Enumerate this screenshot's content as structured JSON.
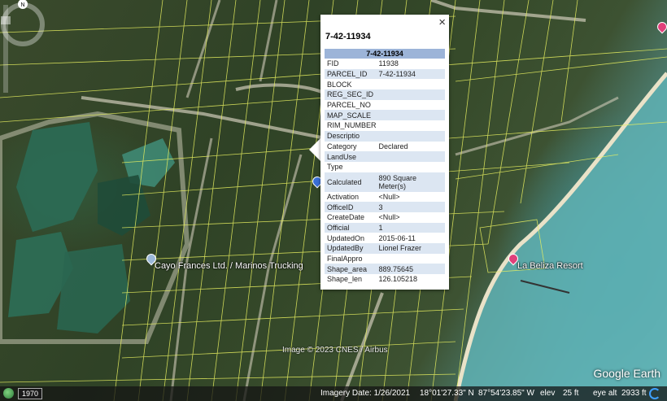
{
  "map": {
    "place_labels": [
      {
        "text": "Cayo Frances Ltd. / Marinos Trucking"
      },
      {
        "text": "La Beliza Resort"
      }
    ],
    "imagery_credit": "Image © 2023 CNES / Airbus",
    "brand": "Google Earth",
    "compass_label": "N"
  },
  "popup": {
    "title": "7-42-11934",
    "table_header": "7-42-11934",
    "close_glyph": "×",
    "rows": [
      {
        "key": "FID",
        "value": "11938"
      },
      {
        "key": "PARCEL_ID",
        "value": "7-42-11934"
      },
      {
        "key": "BLOCK",
        "value": ""
      },
      {
        "key": "REG_SEC_ID",
        "value": ""
      },
      {
        "key": "PARCEL_NO",
        "value": ""
      },
      {
        "key": "MAP_SCALE",
        "value": ""
      },
      {
        "key": "RIM_NUMBER",
        "value": ""
      },
      {
        "key": "Descriptio",
        "value": ""
      },
      {
        "key": "Category",
        "value": "Declared"
      },
      {
        "key": "LandUse",
        "value": ""
      },
      {
        "key": "Type",
        "value": ""
      },
      {
        "key": "Calculated",
        "value": "890 Square Meter(s)"
      },
      {
        "key": "Activation",
        "value": "<Null>"
      },
      {
        "key": "OfficeID",
        "value": "3"
      },
      {
        "key": "CreateDate",
        "value": "<Null>"
      },
      {
        "key": "Official",
        "value": "1"
      },
      {
        "key": "UpdatedOn",
        "value": "2015-06-11"
      },
      {
        "key": "UpdatedBy",
        "value": "Lionel Frazer"
      },
      {
        "key": "FinalAppro",
        "value": ""
      },
      {
        "key": "Shape_area",
        "value": "889.75645"
      },
      {
        "key": "Shape_len",
        "value": "126.105218"
      }
    ]
  },
  "statusbar": {
    "year": "1970",
    "imagery_date": "Imagery Date: 1/26/2021",
    "latitude": "18°01'27.33\" N",
    "longitude": "87°54'23.85\" W",
    "elev_label": "elev",
    "elev_value": "25 ft",
    "eye_alt_label": "eye alt",
    "eye_alt_value": "2933 ft"
  },
  "colors": {
    "parcel_line": "#e8f060",
    "popup_header": "#9cb4d8",
    "popup_alt_row": "#dce6f2",
    "pin_pink": "#e0407a",
    "pin_blue": "#3a6fd8"
  },
  "icons": [
    "close-icon",
    "compass-icon",
    "globe-icon",
    "location-pin-icon",
    "loading-icon"
  ]
}
